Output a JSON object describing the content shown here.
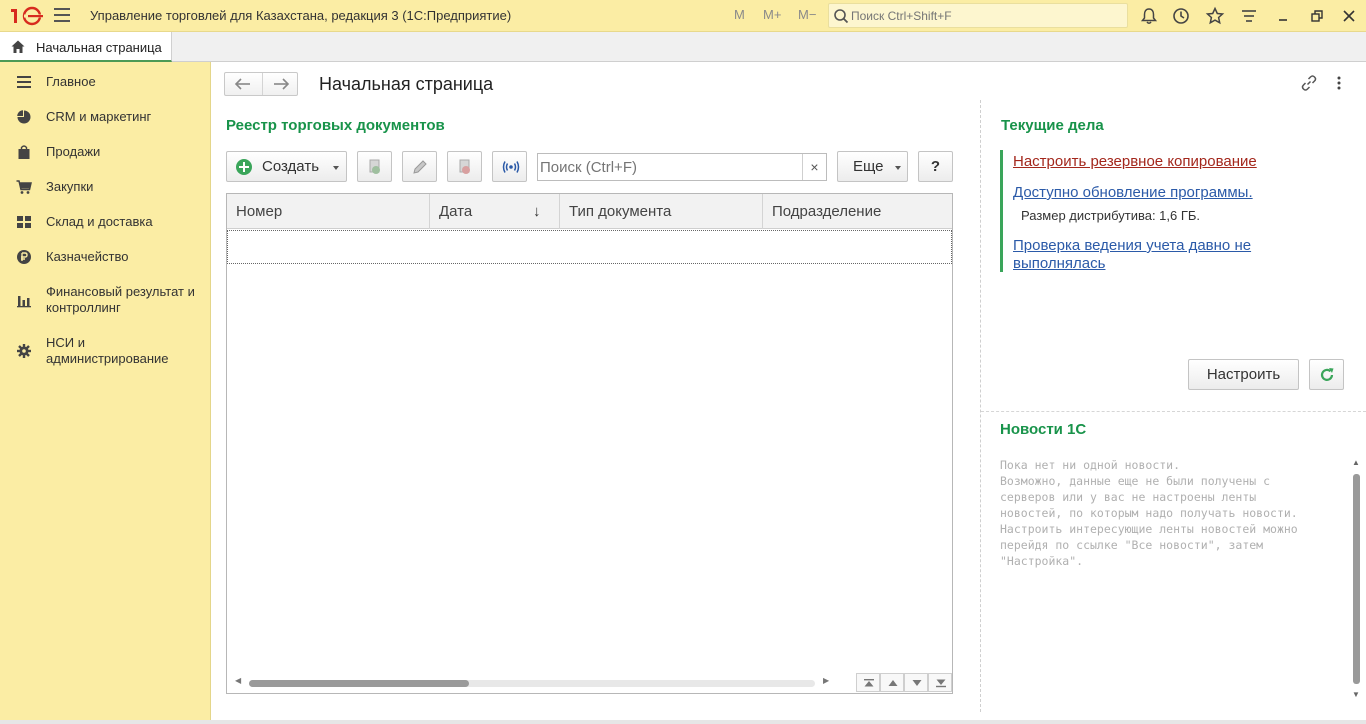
{
  "titlebar": {
    "logo": "1C",
    "title": "Управление торговлей для Казахстана, редакция 3  (1С:Предприятие)",
    "mem_m": "M",
    "mem_mplus": "M+",
    "mem_mminus": "M−",
    "search_placeholder": "Поиск Ctrl+Shift+F",
    "icons": [
      "bell-icon",
      "history-icon",
      "star-icon",
      "settings-icon",
      "minimize-icon",
      "restore-icon",
      "close-icon"
    ]
  },
  "tabbar": {
    "home_tab_label": "Начальная страница"
  },
  "sidebar": {
    "items": [
      {
        "label": "Главное",
        "icon": "menu-icon"
      },
      {
        "label": "CRM и маркетинг",
        "icon": "pie-chart-icon"
      },
      {
        "label": "Продажи",
        "icon": "bag-icon"
      },
      {
        "label": "Закупки",
        "icon": "cart-icon"
      },
      {
        "label": "Склад и доставка",
        "icon": "grid-icon"
      },
      {
        "label": "Казначейство",
        "icon": "currency-icon"
      },
      {
        "label": "Финансовый результат и контроллинг",
        "icon": "bar-chart-icon"
      },
      {
        "label": "НСИ и администрирование",
        "icon": "gear-icon"
      }
    ]
  },
  "main": {
    "page_title": "Начальная страница",
    "registry": {
      "title": "Реестр торговых документов",
      "create_label": "Создать",
      "search_placeholder": "Поиск (Ctrl+F)",
      "clear_label": "×",
      "more_label": "Еще",
      "help_label": "?",
      "columns": [
        "Номер",
        "Дата",
        "Тип документа",
        "Подразделение"
      ],
      "sort_indicator": "↓"
    },
    "tasks": {
      "title": "Текущие дела",
      "items": [
        {
          "label": "Настроить резервное копирование",
          "color": "#a3271c"
        },
        {
          "label": "Доступно обновление программы.",
          "color": "#2b5aa8"
        },
        {
          "label": "Проверка ведения учета давно не выполнялась",
          "color": "#2b5aa8"
        }
      ],
      "note": "Размер дистрибутива: 1,6 ГБ.",
      "setup_label": "Настроить"
    },
    "news": {
      "title": "Новости 1С",
      "text": "Пока нет ни одной новости.\nВозможно, данные еще не были получены с\nсерверов или у вас не настроены ленты\nновостей, по которым надо получать новости.\nНастроить интересующие ленты новостей можно\nперейдя по ссылке \"Все новости\", затем\n\"Настройка\"."
    }
  },
  "colors": {
    "accent_green": "#18934a",
    "sidebar_bg": "#fbeda4",
    "link_red": "#a3271c",
    "link_blue": "#2b5aa8"
  }
}
